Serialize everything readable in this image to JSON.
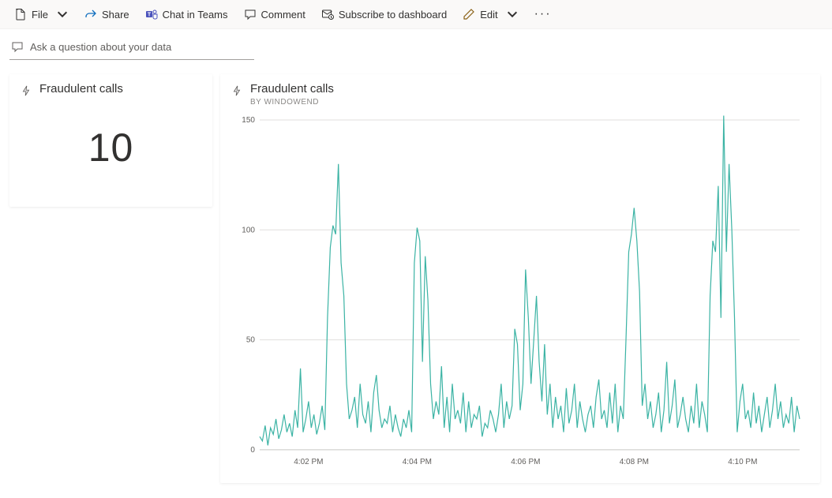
{
  "toolbar": {
    "file_label": "File",
    "share_label": "Share",
    "chat_label": "Chat in Teams",
    "comment_label": "Comment",
    "subscribe_label": "Subscribe to dashboard",
    "edit_label": "Edit",
    "more_label": "..."
  },
  "qa": {
    "placeholder": "Ask a question about your data"
  },
  "card": {
    "title": "Fraudulent calls",
    "value": "10"
  },
  "chart": {
    "title": "Fraudulent calls",
    "subtitle": "BY WINDOWEND",
    "y_ticks": [
      "0",
      "50",
      "100",
      "150"
    ],
    "x_ticks": [
      "4:02 PM",
      "4:04 PM",
      "4:06 PM",
      "4:08 PM",
      "4:10 PM"
    ],
    "series_color": "#3bb3a4"
  },
  "chart_data": {
    "type": "line",
    "title": "Fraudulent calls",
    "subtitle": "BY WINDOWEND",
    "xlabel": "",
    "ylabel": "",
    "ylim": [
      0,
      150
    ],
    "x": [
      0,
      1,
      2,
      3,
      4,
      5,
      6,
      7,
      8,
      9,
      10,
      11,
      12,
      13,
      14,
      15,
      16,
      17,
      18,
      19,
      20,
      21,
      22,
      23,
      24,
      25,
      26,
      27,
      28,
      29,
      30,
      31,
      32,
      33,
      34,
      35,
      36,
      37,
      38,
      39,
      40,
      41,
      42,
      43,
      44,
      45,
      46,
      47,
      48,
      49,
      50,
      51,
      52,
      53,
      54,
      55,
      56,
      57,
      58,
      59,
      60,
      61,
      62,
      63,
      64,
      65,
      66,
      67,
      68,
      69,
      70,
      71,
      72,
      73,
      74,
      75,
      76,
      77,
      78,
      79,
      80,
      81,
      82,
      83,
      84,
      85,
      86,
      87,
      88,
      89,
      90,
      91,
      92,
      93,
      94,
      95,
      96,
      97,
      98,
      99,
      100,
      101,
      102,
      103,
      104,
      105,
      106,
      107,
      108,
      109,
      110,
      111,
      112,
      113,
      114,
      115,
      116,
      117,
      118,
      119,
      120,
      121,
      122,
      123,
      124,
      125,
      126,
      127,
      128,
      129,
      130,
      131,
      132,
      133,
      134,
      135,
      136,
      137,
      138,
      139,
      140,
      141,
      142,
      143,
      144,
      145,
      146,
      147,
      148,
      149,
      150,
      151,
      152,
      153,
      154,
      155,
      156,
      157,
      158,
      159,
      160,
      161,
      162,
      163,
      164,
      165,
      166,
      167,
      168,
      169,
      170,
      171,
      172,
      173,
      174,
      175,
      176,
      177,
      178,
      179,
      180,
      181,
      182,
      183,
      184,
      185,
      186,
      187,
      188,
      189,
      190,
      191,
      192,
      193,
      194,
      195,
      196,
      197,
      198,
      199
    ],
    "values": [
      6,
      4,
      11,
      2,
      10,
      7,
      14,
      5,
      9,
      16,
      8,
      12,
      6,
      18,
      10,
      37,
      8,
      14,
      22,
      10,
      16,
      7,
      12,
      20,
      9,
      60,
      92,
      102,
      98,
      130,
      85,
      70,
      30,
      14,
      18,
      24,
      10,
      30,
      16,
      12,
      22,
      8,
      26,
      34,
      18,
      10,
      14,
      12,
      20,
      8,
      16,
      10,
      6,
      14,
      10,
      18,
      8,
      85,
      101,
      95,
      40,
      88,
      68,
      30,
      14,
      22,
      16,
      38,
      10,
      24,
      8,
      30,
      14,
      18,
      12,
      26,
      8,
      22,
      10,
      16,
      14,
      20,
      6,
      12,
      10,
      18,
      14,
      8,
      16,
      30,
      10,
      22,
      14,
      20,
      55,
      48,
      18,
      30,
      82,
      60,
      30,
      50,
      70,
      40,
      22,
      48,
      16,
      30,
      10,
      24,
      14,
      20,
      8,
      28,
      12,
      18,
      30,
      10,
      22,
      14,
      8,
      16,
      20,
      10,
      24,
      32,
      14,
      18,
      10,
      26,
      12,
      30,
      8,
      20,
      14,
      50,
      90,
      98,
      110,
      95,
      72,
      20,
      30,
      14,
      22,
      10,
      16,
      26,
      8,
      18,
      40,
      12,
      20,
      32,
      10,
      16,
      24,
      14,
      8,
      20,
      12,
      30,
      10,
      22,
      16,
      8,
      70,
      95,
      90,
      120,
      60,
      152,
      90,
      130,
      100,
      60,
      8,
      22,
      30,
      14,
      18,
      10,
      26,
      12,
      20,
      8,
      16,
      24,
      10,
      18,
      30,
      14,
      22,
      10,
      16,
      12,
      24,
      8,
      20,
      14
    ],
    "x_tick_labels": [
      "4:02 PM",
      "4:04 PM",
      "4:06 PM",
      "4:08 PM",
      "4:10 PM"
    ],
    "x_tick_positions": [
      18,
      58,
      98,
      138,
      178
    ]
  }
}
